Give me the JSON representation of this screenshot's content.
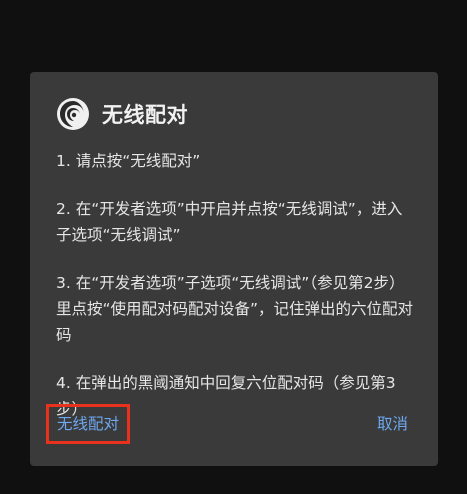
{
  "dialog": {
    "title": "无线配对",
    "icon": "swirl-logo-icon",
    "steps": [
      "1. 请点按“无线配对”",
      "2. 在“开发者选项”中开启并点按“无线调试”，进入子选项“无线调试”",
      "3. 在“开发者选项”子选项“无线调试”（参见第2步）里点按“使用配对码配对设备”，记住弹出的六位配对码",
      "4. 在弹出的黑阈通知中回复六位配对码（参见第3步）"
    ],
    "actions": {
      "pair_label": "无线配对",
      "cancel_label": "取消"
    }
  },
  "colors": {
    "dialog_bg": "#3a3a3a",
    "accent": "#6ea8f0",
    "highlight_border": "#e8321e"
  }
}
